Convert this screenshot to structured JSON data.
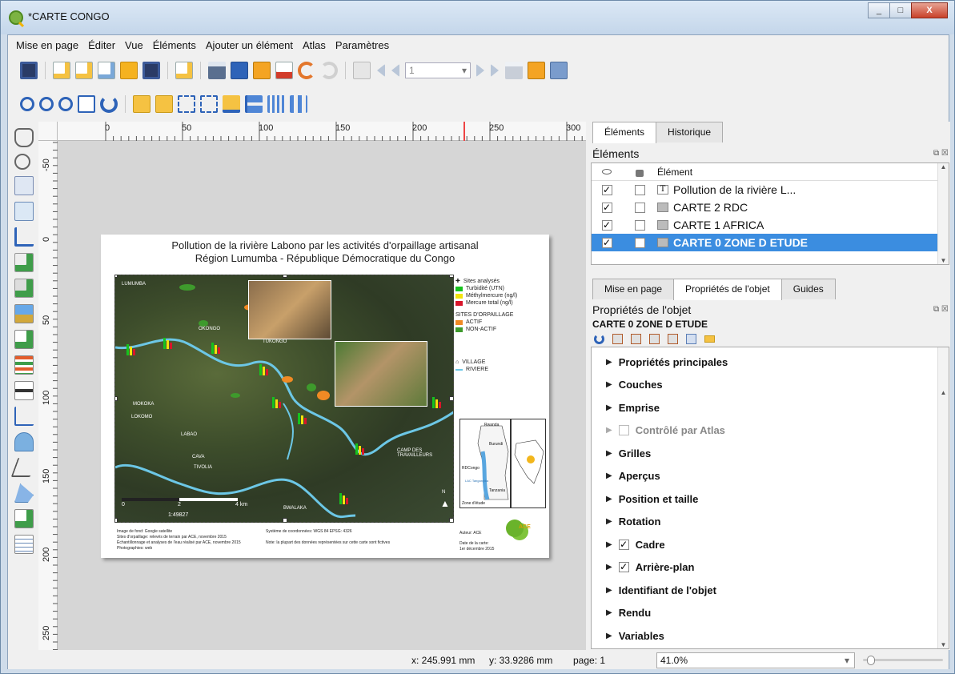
{
  "window": {
    "title": "*CARTE CONGO",
    "min": "_",
    "max": "□",
    "close": "X"
  },
  "menu": [
    "Mise en page",
    "Éditer",
    "Vue",
    "Éléments",
    "Ajouter un élément",
    "Atlas",
    "Paramètres"
  ],
  "toolbar": {
    "page_field": "1"
  },
  "rulers": {
    "h": [
      "0",
      "50",
      "100",
      "150",
      "200",
      "250",
      "300"
    ],
    "v": [
      "-50",
      "0",
      "50",
      "100",
      "150",
      "200",
      "250"
    ]
  },
  "map": {
    "title_line1": "Pollution de la rivière Labono par les activités d'orpaillage artisanal",
    "title_line2": "Région Lumumba - République Démocratique du Congo",
    "scale_ratio": "1:49827",
    "scale_labels": [
      "0",
      "2",
      "4  km"
    ],
    "places": [
      "LUMUMBA",
      "OKONGO",
      "TUKONGO",
      "MOKOKA",
      "LOKOMO",
      "LABAO",
      "CAVA",
      "TIVOLIA",
      "BWALAKA",
      "CAMP DES TRAVAILLEURS"
    ],
    "legend": {
      "sites_title": "Sites analysés",
      "items": [
        {
          "label": "Turbidité (UTN)",
          "color": "#16c21e"
        },
        {
          "label": "Méthylmercure (ng/l)",
          "color": "#f2e40c"
        },
        {
          "label": "Mercure total (ng/l)",
          "color": "#d8152a"
        }
      ],
      "orpaillage_title": "SITES D'ORPAILLAGE",
      "orpaillage": [
        {
          "label": "ACTIF",
          "color": "#f08a24"
        },
        {
          "label": "NON-ACTIF",
          "color": "#3e9a2c"
        }
      ],
      "village": "VILLAGE",
      "riviere": "RIVIERE",
      "north": "N"
    },
    "inset_labels": [
      "Rwanda",
      "Burundi",
      "RDCongo",
      "LAC Tanganyika",
      "Tanzania",
      "Zone d'étude"
    ],
    "footer_left": "Image de fond: Google satellite\nSites d'orpaillage: relevés de terrain par ACE, novembre 2015\nÉchantillonnage et analyses de l'eau réalisé par ACE, novembre 2015\nPhotographies: web",
    "footer_mid": "Système de coordonnées: WGS 84 EPSG: 4326\n\nNote: la plupart des données représentées sur cette carte sont fictives",
    "footer_author": "Auteur: ACE",
    "footer_date": "Date de la carte:\n1er décembre 2015"
  },
  "right_panel": {
    "top_tabs": [
      "Éléments",
      "Historique"
    ],
    "elements_title": "Éléments",
    "tree_header": "Élément",
    "tree_items": [
      {
        "label": "Pollution de la rivière L...",
        "type": "text",
        "visible": "✓",
        "selected": false
      },
      {
        "label": "CARTE 2 RDC",
        "type": "map",
        "visible": "✓",
        "selected": false
      },
      {
        "label": "CARTE 1 AFRICA",
        "type": "map",
        "visible": "✓",
        "selected": false
      },
      {
        "label": "CARTE 0 ZONE D ETUDE",
        "type": "map",
        "visible": "✓",
        "selected": true
      }
    ],
    "bottom_tabs": [
      "Mise en page",
      "Propriétés de l'objet",
      "Guides"
    ],
    "props_title": "Propriétés de l'objet",
    "props_item": "CARTE 0 ZONE D ETUDE",
    "sections": [
      {
        "label": "Propriétés principales",
        "check": ""
      },
      {
        "label": "Couches",
        "check": ""
      },
      {
        "label": "Emprise",
        "check": ""
      },
      {
        "label": "Contrôlé par Atlas",
        "check": " ",
        "dim": true
      },
      {
        "label": "Grilles",
        "check": ""
      },
      {
        "label": "Aperçus",
        "check": ""
      },
      {
        "label": "Position et taille",
        "check": ""
      },
      {
        "label": "Rotation",
        "check": ""
      },
      {
        "label": "Cadre",
        "check": "✓"
      },
      {
        "label": "Arrière-plan",
        "check": "✓"
      },
      {
        "label": "Identifiant de l'objet",
        "check": ""
      },
      {
        "label": "Rendu",
        "check": ""
      },
      {
        "label": "Variables",
        "check": ""
      }
    ]
  },
  "status": {
    "x": "x: 245.991 mm",
    "y": "y: 33.9286 mm",
    "page": "page: 1",
    "zoom": "41.0%",
    "zoom_fraction": 0.05
  }
}
